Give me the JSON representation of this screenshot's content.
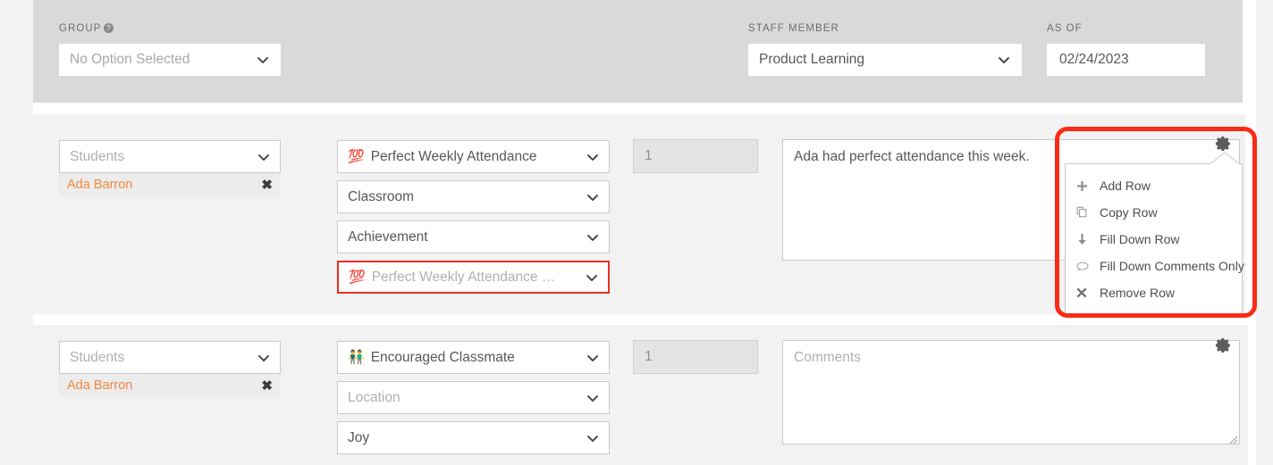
{
  "filters": {
    "group": {
      "label": "GROUP",
      "help_icon": "question-mark-icon",
      "value": "No Option Selected",
      "is_placeholder": true
    },
    "staff_member": {
      "label": "STAFF MEMBER",
      "value": "Product Learning",
      "is_placeholder": false
    },
    "as_of": {
      "label": "AS OF",
      "value": "02/24/2023"
    }
  },
  "rows": [
    {
      "student_select_placeholder": "Students",
      "student_chip": "Ada Barron",
      "remove_student_glyph": "✖",
      "selects": [
        {
          "emoji": "💯",
          "label": "Perfect Weekly Attendance",
          "muted": false,
          "highlight": false
        },
        {
          "emoji": "",
          "label": "Classroom",
          "muted": false,
          "highlight": false
        },
        {
          "emoji": "",
          "label": "Achievement",
          "muted": false,
          "highlight": false
        },
        {
          "emoji": "💯",
          "label": "Perfect Weekly Attendance …",
          "muted": true,
          "highlight": true
        }
      ],
      "quantity": "1",
      "comment": "Ada had perfect attendance this week.",
      "comment_is_placeholder": false
    },
    {
      "student_select_placeholder": "Students",
      "student_chip": "Ada Barron",
      "remove_student_glyph": "✖",
      "selects": [
        {
          "emoji": "👬",
          "label": "Encouraged Classmate",
          "muted": false,
          "highlight": false
        },
        {
          "emoji": "",
          "label": "Location",
          "muted": true,
          "highlight": false
        },
        {
          "emoji": "",
          "label": "Joy",
          "muted": false,
          "highlight": false
        }
      ],
      "quantity": "1",
      "comment": "Comments",
      "comment_is_placeholder": true
    }
  ],
  "row_menu": {
    "trigger_icon": "gear-icon",
    "items": [
      {
        "icon": "plus-icon",
        "label": "Add Row"
      },
      {
        "icon": "copy-icon",
        "label": "Copy Row"
      },
      {
        "icon": "arrow-down-icon",
        "label": "Fill Down Row"
      },
      {
        "icon": "speech-bubble-icon",
        "label": "Fill Down Comments Only"
      },
      {
        "icon": "close-x-icon",
        "label": "Remove Row"
      }
    ]
  },
  "colors": {
    "accent_orange": "#f0883e",
    "highlight_red": "#f92b17",
    "filter_bar_bg": "#d9d9d9",
    "row_bg": "#f2f2f2"
  }
}
